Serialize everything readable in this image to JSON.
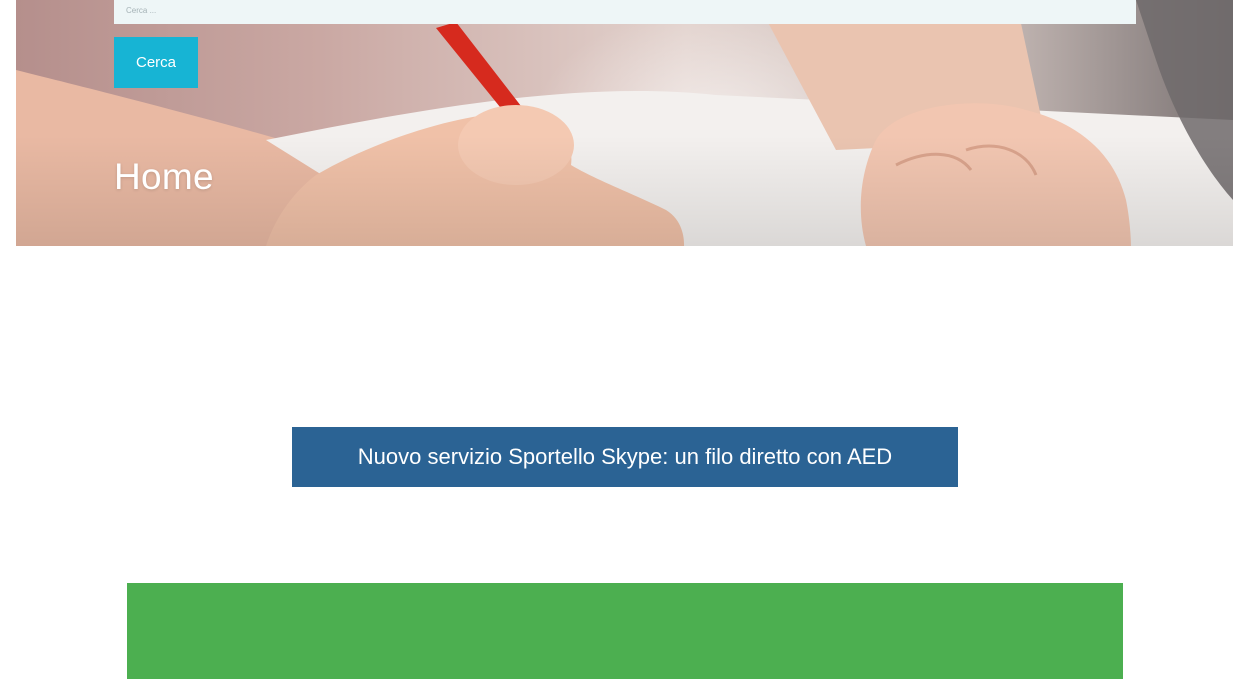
{
  "search": {
    "placeholder": "Cerca ...",
    "button_label": "Cerca"
  },
  "hero": {
    "title": "Home"
  },
  "news_banner": {
    "label": "Nuovo servizio Sportello Skype: un filo diretto con AED"
  },
  "colors": {
    "accent_button": "#17b4d4",
    "banner_blue": "#2b6394",
    "panel_green": "#4caf50"
  }
}
